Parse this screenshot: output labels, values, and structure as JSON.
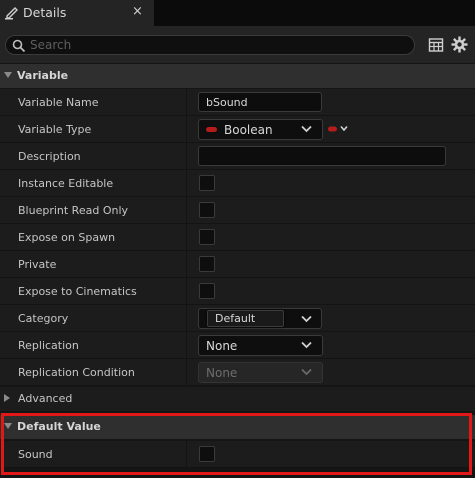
{
  "tab": {
    "title": "Details",
    "close_glyph": "×",
    "icon": "pencil-icon"
  },
  "search": {
    "placeholder": "Search"
  },
  "toolbar": {
    "grid_icon": "table-view-icon",
    "settings_icon": "gear-icon"
  },
  "variable_section": {
    "title": "Variable",
    "rows": {
      "variable_name": {
        "label": "Variable Name",
        "value": "bSound"
      },
      "variable_type": {
        "label": "Variable Type",
        "value": "Boolean",
        "pin_color": "#b71c1c"
      },
      "description": {
        "label": "Description",
        "value": ""
      },
      "instance_editable": {
        "label": "Instance Editable",
        "checked": false
      },
      "blueprint_read_only": {
        "label": "Blueprint Read Only",
        "checked": false
      },
      "expose_on_spawn": {
        "label": "Expose on Spawn",
        "checked": false
      },
      "private": {
        "label": "Private",
        "checked": false
      },
      "expose_to_cinematics": {
        "label": "Expose to Cinematics",
        "checked": false
      },
      "category": {
        "label": "Category",
        "value": "Default"
      },
      "replication": {
        "label": "Replication",
        "value": "None"
      },
      "replication_condition": {
        "label": "Replication Condition",
        "value": "None",
        "enabled": false
      }
    },
    "advanced_label": "Advanced"
  },
  "default_value_section": {
    "title": "Default Value",
    "rows": {
      "sound": {
        "label": "Sound",
        "checked": false
      }
    }
  },
  "colors": {
    "highlight": "#e01818",
    "panel_bg": "#1c1c1c",
    "header_bg": "#2f2f2f"
  }
}
